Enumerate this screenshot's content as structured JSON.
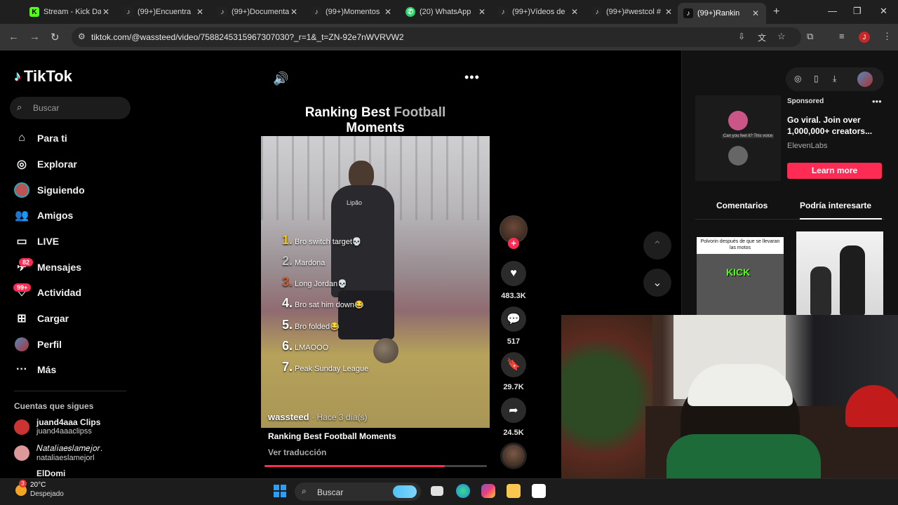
{
  "browser": {
    "tabs": [
      {
        "label": "Stream - Kick Da",
        "fav_color": "#53fc18",
        "fav_glyph": "K"
      },
      {
        "label": "(99+)Encuentra",
        "fav_color": "#222222",
        "fav_glyph": "♪"
      },
      {
        "label": "(99+)Documenta",
        "fav_color": "#222222",
        "fav_glyph": "♪"
      },
      {
        "label": "(99+)Momentos",
        "fav_color": "#222222",
        "fav_glyph": "♪"
      },
      {
        "label": "(20) WhatsApp",
        "fav_color": "#25d366",
        "fav_glyph": "✆"
      },
      {
        "label": "(99+)Vídeos de",
        "fav_color": "#222222",
        "fav_glyph": "♪"
      },
      {
        "label": "(99+)#westcol #",
        "fav_color": "#222222",
        "fav_glyph": "♪"
      },
      {
        "label": "(99+)Rankin",
        "fav_color": "#222222",
        "fav_glyph": "♪"
      }
    ],
    "url": "tiktok.com/@wassteed/video/7588245315967307030?_r=1&_t=ZN-92e7nWVRVW2",
    "profile_initial": "J"
  },
  "sidebar": {
    "logo": "TikTok",
    "search_placeholder": "Buscar",
    "items": [
      {
        "label": "Para ti",
        "icon": "home-icon"
      },
      {
        "label": "Explorar",
        "icon": "compass-icon"
      },
      {
        "label": "Siguiendo",
        "icon": "following-avatar-icon"
      },
      {
        "label": "Amigos",
        "icon": "friends-icon"
      },
      {
        "label": "LIVE",
        "icon": "live-icon"
      },
      {
        "label": "Mensajes",
        "icon": "messages-icon",
        "badge": "82"
      },
      {
        "label": "Actividad",
        "icon": "activity-icon",
        "badge": "99+"
      },
      {
        "label": "Cargar",
        "icon": "upload-icon"
      },
      {
        "label": "Perfil",
        "icon": "profile-avatar-icon"
      },
      {
        "label": "Más",
        "icon": "more-icon"
      }
    ],
    "following_title": "Cuentas que sigues",
    "accounts": [
      {
        "name": "juand4aaa Clips",
        "handle": "juand4aaaclipss"
      },
      {
        "name": "𝑁𝑎𝑡𝑎𝑙𝑖𝑎𝑒𝑠𝑙𝑎𝑚𝑒𝑗𝑜𝑟.",
        "handle": "nataliaeslamejorl"
      },
      {
        "name": "ElDomi",
        "handle": ""
      }
    ]
  },
  "video": {
    "title_bold": "Ranking Best",
    "title_dim": "Football",
    "title_line2": "Moments",
    "ranking": [
      {
        "n": "1.",
        "text": "Bro switch target💀",
        "color": "#f5c518"
      },
      {
        "n": "2.",
        "text": "Mardona",
        "color": "#c0c0c0"
      },
      {
        "n": "3.",
        "text": "Long Jordan💀",
        "color": "#cd5c2e"
      },
      {
        "n": "4.",
        "text": "Bro sat him down😂",
        "color": "#ffffff"
      },
      {
        "n": "5.",
        "text": "Bro folded😂",
        "color": "#ffffff"
      },
      {
        "n": "6.",
        "text": "LMAOOO",
        "color": "#ffffff"
      },
      {
        "n": "7.",
        "text": "Peak Sunday League",
        "color": "#ffffff"
      }
    ],
    "shirt_text": "Lipão",
    "author": "wassteed",
    "posted": "· Hace 3 día(s)",
    "description": "Ranking Best Football Moments",
    "translate": "Ver traducción",
    "progress": 0.81,
    "likes": "483.3K",
    "comments": "517",
    "saves": "29.7K",
    "shares": "24.5K"
  },
  "right_panel": {
    "sponsored": "Sponsored",
    "ad_text": "Go viral. Join over 1,000,000+ creators...",
    "ad_brand": "ElevenLabs",
    "ad_caption": "Can you feel it? This voice",
    "cta": "Learn more",
    "tabs": [
      "Comentarios",
      "Podría interesarte"
    ],
    "thumb1_caption": "Polvorin después de que se llevaran las motos",
    "thumb1_logo": "KICK"
  },
  "taskbar": {
    "temp": "20°C",
    "condition": "Despejado",
    "weather_badge": "3",
    "search": "Buscar"
  },
  "colors": {
    "accent": "#fe2c55",
    "kick": "#53fc18"
  }
}
